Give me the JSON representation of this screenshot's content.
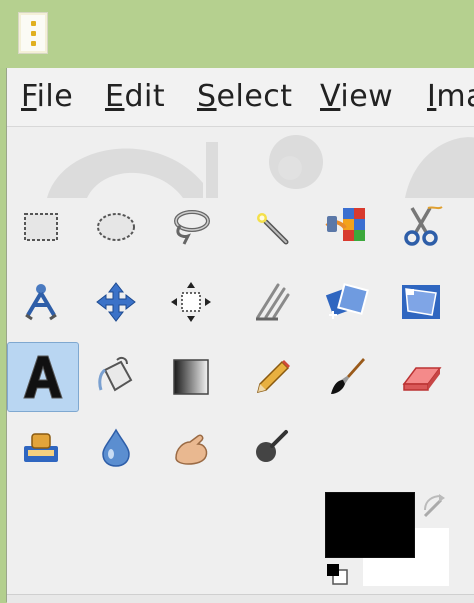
{
  "menubar": {
    "items": [
      {
        "label": "File",
        "mnemonic": "F",
        "rest": "ile"
      },
      {
        "label": "Edit",
        "mnemonic": "E",
        "rest": "dit"
      },
      {
        "label": "Select",
        "mnemonic": "S",
        "rest": "elect"
      },
      {
        "label": "View",
        "mnemonic": "V",
        "rest": "iew"
      },
      {
        "label": "Ima",
        "mnemonic": "I",
        "rest": "ma"
      }
    ]
  },
  "toolbox": {
    "active_tool": "text-tool",
    "tools": [
      "rect-select-tool",
      "ellipse-select-tool",
      "free-select-tool",
      "fuzzy-select-tool",
      "select-by-color-tool",
      "scissors-select-tool",
      "foreground-select-tool",
      "move-tool",
      "align-tool",
      "crop-tool",
      "transform-tool",
      "perspective-tool",
      "text-tool",
      "bucket-fill-tool",
      "blend-tool",
      "pencil-tool",
      "paintbrush-tool",
      "eraser-tool",
      "clone-tool",
      "smudge-tool",
      "dodge-burn-tool",
      "airbrush-tool"
    ]
  },
  "colors": {
    "foreground": "#000000",
    "background": "#ffffff",
    "titlebar": "#b5d08f",
    "selection": "#b9d6f2"
  }
}
